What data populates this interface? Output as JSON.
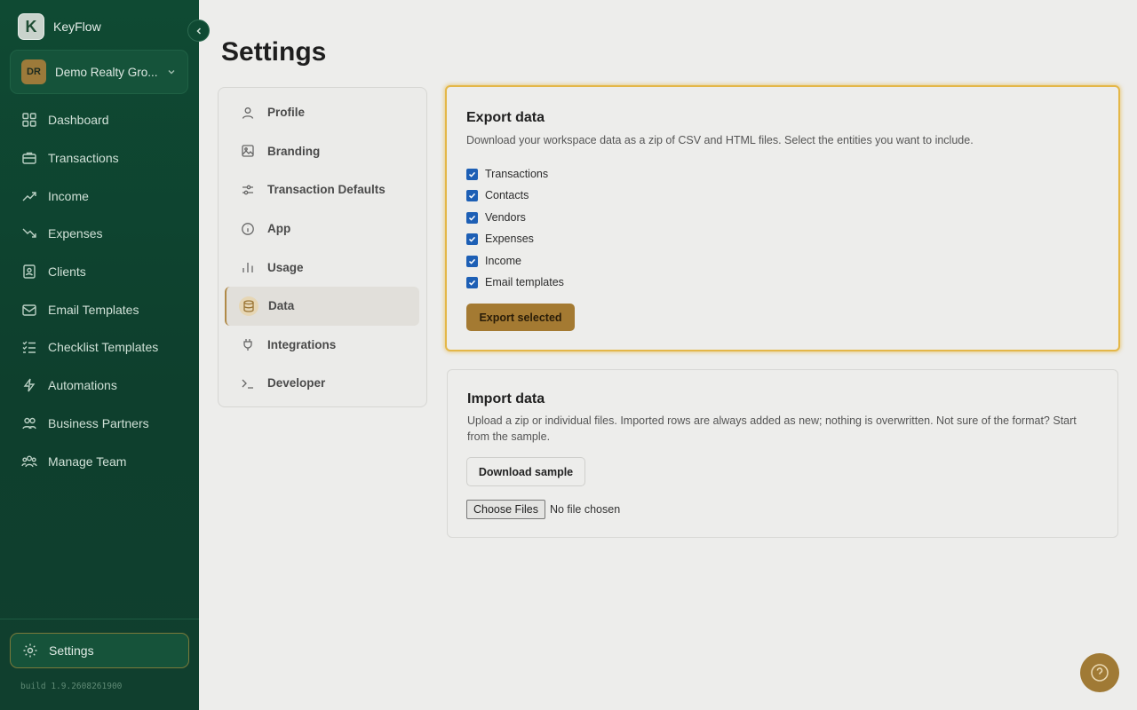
{
  "app": {
    "name": "KeyFlow",
    "logo_letter": "K"
  },
  "org": {
    "initials": "DR",
    "name": "Demo Realty Gro..."
  },
  "sidebar": {
    "items": [
      {
        "label": "Dashboard",
        "icon": "dashboard-icon"
      },
      {
        "label": "Transactions",
        "icon": "briefcase-icon"
      },
      {
        "label": "Income",
        "icon": "trending-up-icon"
      },
      {
        "label": "Expenses",
        "icon": "trending-down-icon"
      },
      {
        "label": "Clients",
        "icon": "contacts-icon"
      },
      {
        "label": "Email Templates",
        "icon": "mail-icon"
      },
      {
        "label": "Checklist Templates",
        "icon": "checklist-icon"
      },
      {
        "label": "Automations",
        "icon": "bolt-icon"
      },
      {
        "label": "Business Partners",
        "icon": "users-icon"
      },
      {
        "label": "Manage Team",
        "icon": "team-icon"
      }
    ],
    "settings_label": "Settings",
    "build": "build 1.9.2608261900"
  },
  "page": {
    "title": "Settings"
  },
  "subnav": {
    "items": [
      {
        "label": "Profile",
        "icon": "user-icon"
      },
      {
        "label": "Branding",
        "icon": "image-icon"
      },
      {
        "label": "Transaction Defaults",
        "icon": "sliders-icon"
      },
      {
        "label": "App",
        "icon": "info-icon"
      },
      {
        "label": "Usage",
        "icon": "bar-chart-icon"
      },
      {
        "label": "Data",
        "icon": "database-icon"
      },
      {
        "label": "Integrations",
        "icon": "plug-icon"
      },
      {
        "label": "Developer",
        "icon": "terminal-icon"
      }
    ],
    "active": "Data"
  },
  "export": {
    "title": "Export data",
    "description": "Download your workspace data as a zip of CSV and HTML files. Select the entities you want to include.",
    "options": [
      {
        "label": "Transactions",
        "checked": true
      },
      {
        "label": "Contacts",
        "checked": true
      },
      {
        "label": "Vendors",
        "checked": true
      },
      {
        "label": "Expenses",
        "checked": true
      },
      {
        "label": "Income",
        "checked": true
      },
      {
        "label": "Email templates",
        "checked": true
      }
    ],
    "button_label": "Export selected"
  },
  "import": {
    "title": "Import data",
    "description": "Upload a zip or individual files. Imported rows are always added as new; nothing is overwritten. Not sure of the format? Start from the sample.",
    "sample_button": "Download sample",
    "file_button": "Choose Files",
    "file_status": "No file chosen"
  },
  "colors": {
    "sidebar_bg": "#0f4a33",
    "accent": "#a47a32",
    "highlight": "#e4b748",
    "checkbox": "#1d5fb5"
  }
}
